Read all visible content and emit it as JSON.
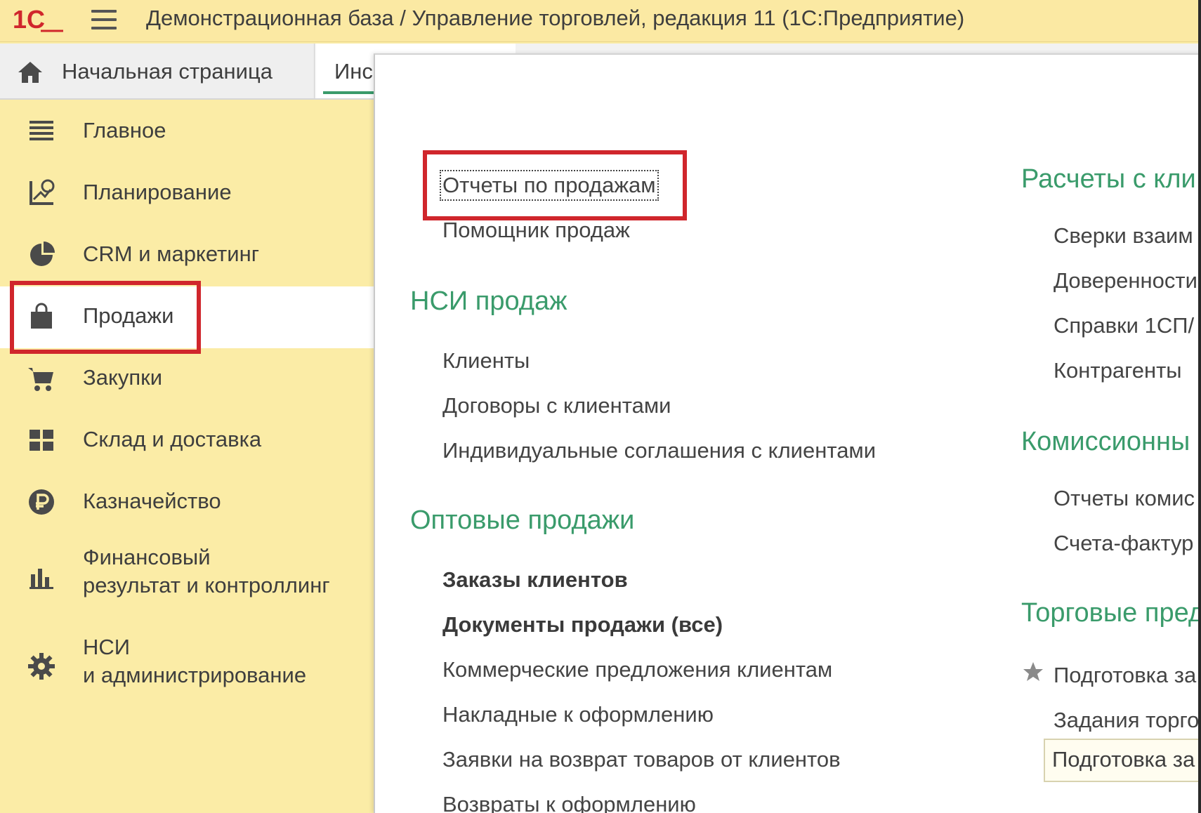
{
  "app": {
    "logo_text": "1С",
    "title": "Демонстрационная база / Управление торговлей, редакция 11  (1С:Предприятие)"
  },
  "tabs": {
    "home_label": "Начальная страница",
    "active_label": "Инс"
  },
  "sidebar": {
    "items": [
      {
        "label": "Главное",
        "icon": "list-icon"
      },
      {
        "label": "Планирование",
        "icon": "planning-icon"
      },
      {
        "label": "CRM и маркетинг",
        "icon": "pie-chart-icon"
      },
      {
        "label": "Продажи",
        "icon": "shopping-bag-icon",
        "active": true
      },
      {
        "label": "Закупки",
        "icon": "cart-icon"
      },
      {
        "label": "Склад и доставка",
        "icon": "grid-icon"
      },
      {
        "label": "Казначейство",
        "icon": "ruble-icon"
      },
      {
        "label_line1": "Финансовый",
        "label_line2": "результат и контроллинг",
        "icon": "bar-chart-icon"
      },
      {
        "label_line1": "НСИ",
        "label_line2": "и администрирование",
        "icon": "gear-icon"
      }
    ]
  },
  "main": {
    "col1": {
      "top_links": [
        "Отчеты по продажам",
        "Помощник продаж"
      ],
      "sections": [
        {
          "title": "НСИ продаж",
          "links": [
            "Клиенты",
            "Договоры с клиентами",
            "Индивидуальные соглашения с клиентами"
          ]
        },
        {
          "title": "Оптовые продажи",
          "bold_links": [
            "Заказы клиентов",
            "Документы продажи (все)"
          ],
          "links": [
            "Коммерческие предложения клиентам",
            "Накладные к оформлению",
            "Заявки на возврат товаров от клиентов",
            "Возвраты к оформлению"
          ]
        }
      ]
    },
    "col2": {
      "sections": [
        {
          "title": "Расчеты с кли",
          "links": [
            "Сверки взаим",
            "Доверенности",
            "Справки 1СП/",
            "Контрагенты"
          ]
        },
        {
          "title": "Комиссионны",
          "links": [
            "Отчеты комис",
            "Счета-фактур"
          ]
        },
        {
          "title": "Торговые пред",
          "links": [
            "Подготовка за",
            "Задания торго"
          ],
          "tooltip": "Подготовка за"
        }
      ]
    }
  },
  "colors": {
    "sidebar_bg": "#fbeca6",
    "accent_green": "#3a9b6b",
    "highlight_red": "#d0262c"
  }
}
